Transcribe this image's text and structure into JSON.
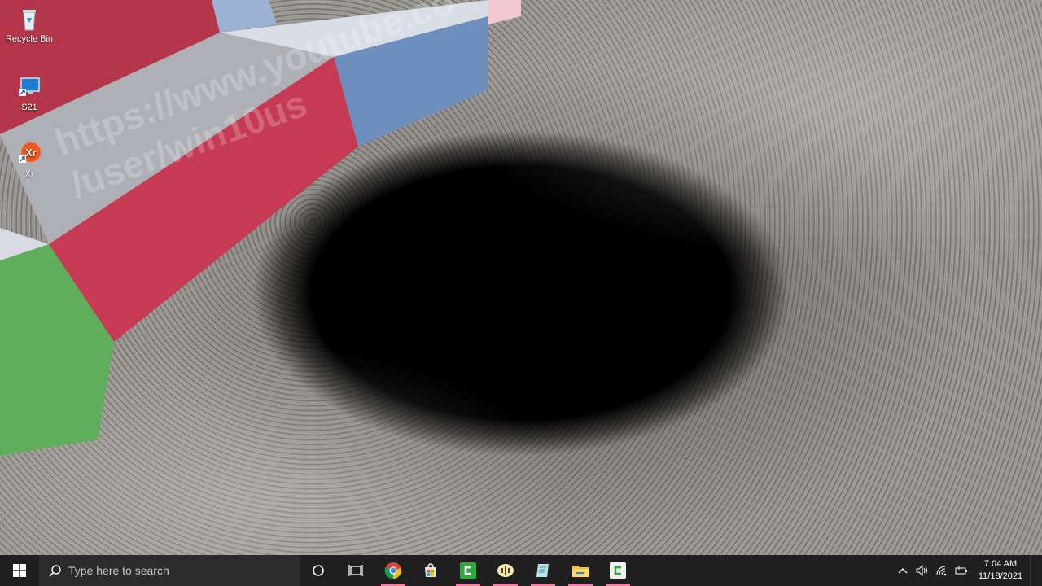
{
  "desktop": {
    "watermark_line1": "https://www.youtube.co",
    "watermark_line2": "/user/win10us",
    "icons": [
      {
        "label": "Recycle Bin",
        "icon": "recycle-bin-icon"
      },
      {
        "label": "S21",
        "icon": "shortcut-monitor-icon"
      },
      {
        "label": "Xr",
        "icon": "xr-app-icon"
      }
    ]
  },
  "taskbar": {
    "search_placeholder": "Type here to search",
    "apps": [
      {
        "icon": "cortana-circle-icon"
      },
      {
        "icon": "task-view-icon"
      },
      {
        "icon": "chrome-icon",
        "active": true
      },
      {
        "icon": "store-icon",
        "active": false
      },
      {
        "icon": "camtasia-green-icon",
        "active": true
      },
      {
        "icon": "audio-app-icon",
        "active": true
      },
      {
        "icon": "notepad-app-icon",
        "active": true
      },
      {
        "icon": "file-explorer-icon",
        "active": true
      },
      {
        "icon": "camtasia-white-icon",
        "active": true
      }
    ],
    "clock": {
      "time": "7:04 AM",
      "date": "11/18/2021"
    }
  }
}
